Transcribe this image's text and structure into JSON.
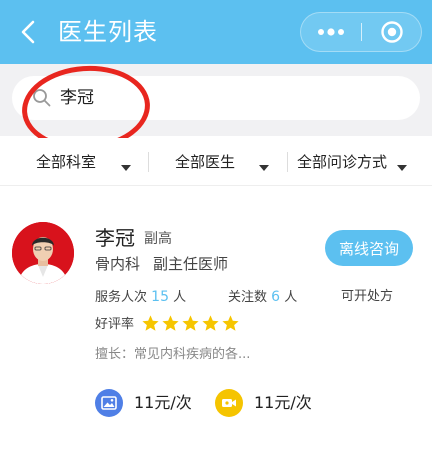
{
  "header": {
    "title": "医生列表",
    "background": "#5cc0f0",
    "icons": [
      "back-icon",
      "more-icon",
      "close-target-icon"
    ]
  },
  "search": {
    "value": "李冠",
    "icon": "search-icon",
    "annotation_color": "#e8261f"
  },
  "filters": [
    {
      "label": "全部科室"
    },
    {
      "label": "全部医生"
    },
    {
      "label": "全部问诊方式"
    }
  ],
  "doctor": {
    "name": "李冠",
    "rank": "副高",
    "department": "骨内科",
    "title": "副主任医师",
    "consult_button": "离线咨询",
    "stats": {
      "served_label": "服务人次",
      "served_value": "15",
      "served_unit": "人",
      "followers_label": "关注数",
      "followers_value": "6",
      "followers_unit": "人",
      "prescription": "可开处方"
    },
    "rating_label": "好评率",
    "rating_stars": 5,
    "specialty": "擅长：常见内科疾病的各...",
    "prices": [
      {
        "icon": "image-consult-icon",
        "color": "#4f7fe6",
        "text": "11元/次"
      },
      {
        "icon": "video-consult-icon",
        "color": "#f5c400",
        "text": "11元/次"
      }
    ],
    "accent_color": "#5cc0f0",
    "star_color": "#f6c500"
  }
}
